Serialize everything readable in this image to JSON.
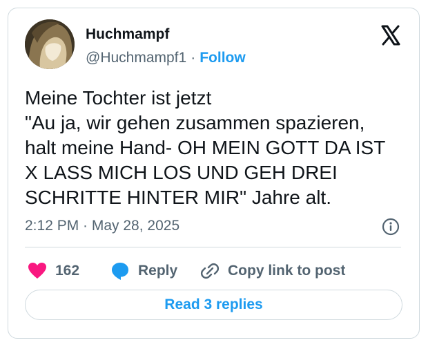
{
  "author": {
    "display_name": "Huchmampf",
    "handle": "@Huchmampf1",
    "separator": "·",
    "follow_label": "Follow"
  },
  "tweet": {
    "lines": [
      "Meine Tochter ist jetzt",
      "\"Au ja, wir gehen zusammen spazieren,",
      "halt meine Hand- OH MEIN GOTT DA IST",
      "X LASS MICH LOS UND GEH DREI",
      "SCHRITTE HINTER MIR\" Jahre alt."
    ],
    "timestamp": "2:12 PM · May 28, 2025"
  },
  "actions": {
    "like_count": "162",
    "reply_label": "Reply",
    "copy_link_label": "Copy link to post"
  },
  "read_replies_label": "Read 3 replies",
  "icons": {
    "brand_logo": "x-logo-icon",
    "info": "info-icon",
    "like": "heart-icon",
    "reply": "speech-bubble-icon",
    "copy_link": "link-icon"
  },
  "colors": {
    "accent": "#1d9bf0",
    "like": "#f91880",
    "secondary_text": "#536471",
    "border": "#cfd9de"
  }
}
